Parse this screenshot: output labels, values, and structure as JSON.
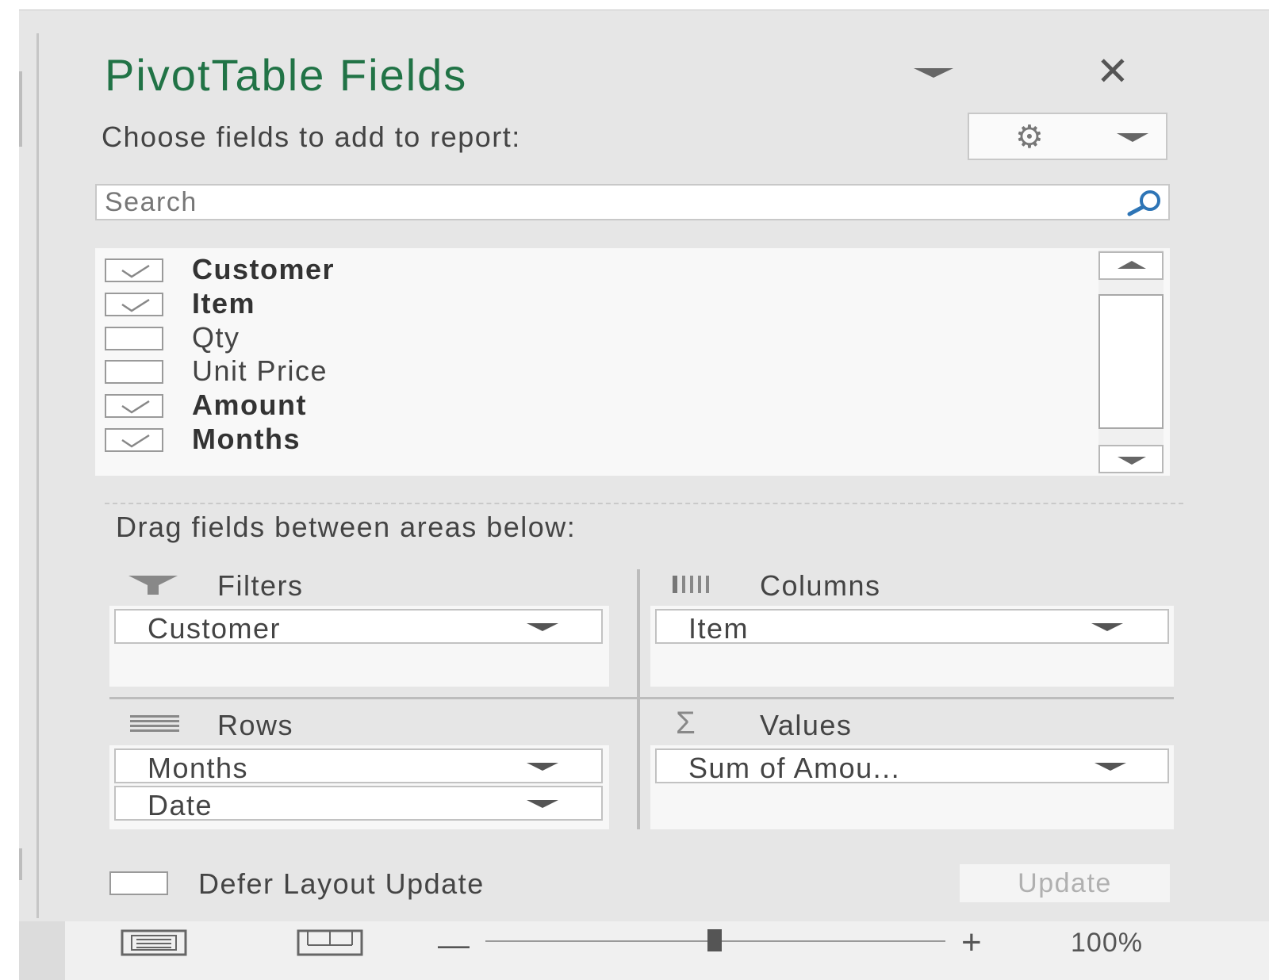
{
  "pane": {
    "title": "PivotTable Fields",
    "choose_label": "Choose fields to add to report:",
    "tools_icon": "gear-icon",
    "accent_color": "#217346"
  },
  "search": {
    "placeholder": "Search",
    "value": ""
  },
  "fields": [
    {
      "label": "Customer",
      "checked": true
    },
    {
      "label": "Item",
      "checked": true
    },
    {
      "label": "Qty",
      "checked": false
    },
    {
      "label": "Unit Price",
      "checked": false
    },
    {
      "label": "Amount",
      "checked": true
    },
    {
      "label": "Months",
      "checked": true
    }
  ],
  "drag_label": "Drag fields between areas below:",
  "areas": {
    "filters": {
      "label": "Filters",
      "items": [
        "Customer"
      ]
    },
    "columns": {
      "label": "Columns",
      "items": [
        "Item"
      ]
    },
    "rows": {
      "label": "Rows",
      "items": [
        "Months",
        "Date"
      ]
    },
    "values": {
      "label": "Values",
      "items": [
        "Sum of Amou..."
      ]
    }
  },
  "defer": {
    "label": "Defer Layout Update",
    "checked": false,
    "update_label": "Update"
  },
  "status": {
    "zoom": "100%"
  }
}
